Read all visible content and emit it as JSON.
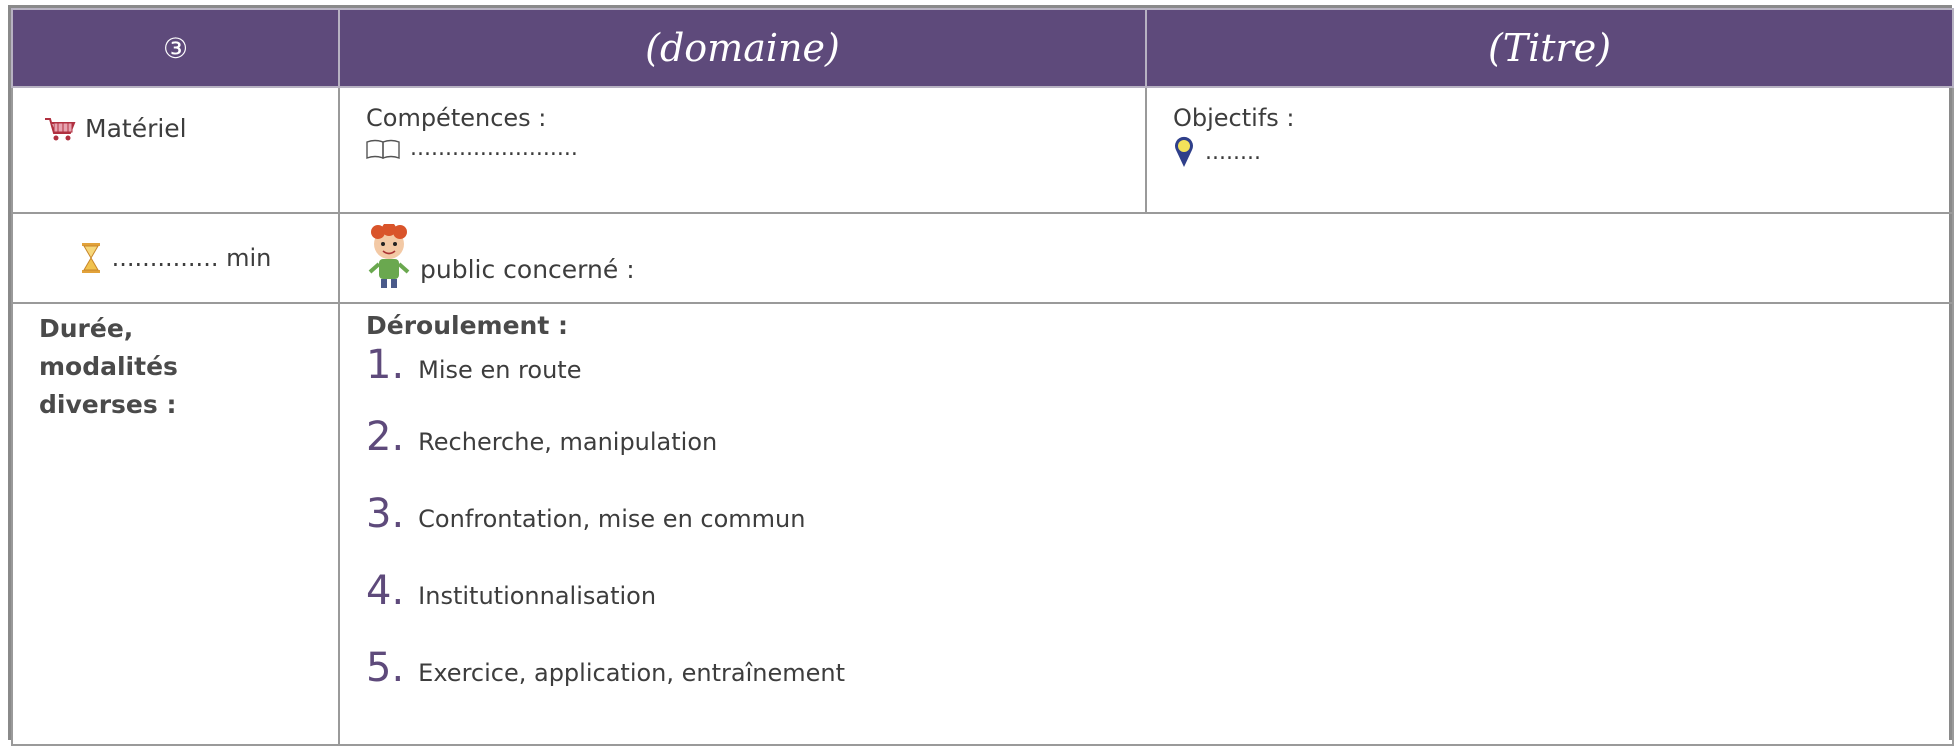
{
  "header": {
    "number": "③",
    "domain": "(domaine)",
    "title": "(Titre)"
  },
  "row_materiel": {
    "materiel_label": "Matériel",
    "competences_label": "Compétences :",
    "competences_value": "........................",
    "objectifs_label": "Objectifs :",
    "objectifs_value": "........"
  },
  "row_duree": {
    "duree_value": ".............. min",
    "public_label": "public concerné :"
  },
  "row_deroulement": {
    "left_label": "Durée, modalités diverses :",
    "deroulement_label": "Déroulement :",
    "steps": [
      {
        "num": "1.",
        "text": "Mise en route"
      },
      {
        "num": "2.",
        "text": "Recherche, manipulation"
      },
      {
        "num": "3.",
        "text": "Confrontation, mise en commun"
      },
      {
        "num": "4.",
        "text": "Institutionnalisation"
      },
      {
        "num": "5.",
        "text": "Exercice, application, entraînement"
      }
    ]
  },
  "colors": {
    "header_bg": "#5e4a7b",
    "step_number": "#5e4a7b",
    "border": "#9a9a9a"
  },
  "icons": [
    "cart-icon",
    "book-icon",
    "location-pin-icon",
    "hourglass-icon",
    "child-character-icon"
  ]
}
